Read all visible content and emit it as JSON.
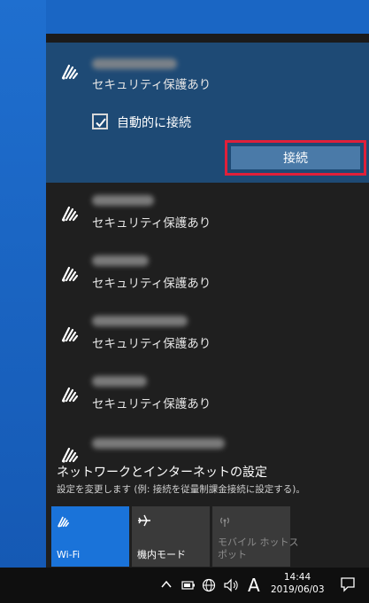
{
  "selected_network": {
    "status": "セキュリティ保護あり",
    "auto_connect_label": "自動的に接続",
    "auto_connect_checked": true,
    "connect_button_label": "接続"
  },
  "networks": [
    {
      "status": "セキュリティ保護あり"
    },
    {
      "status": "セキュリティ保護あり"
    },
    {
      "status": "セキュリティ保護あり"
    },
    {
      "status": "セキュリティ保護あり"
    }
  ],
  "settings": {
    "title": "ネットワークとインターネットの設定",
    "subtitle": "設定を変更します (例: 接続を従量制課金接続に設定する)。"
  },
  "quick_actions": [
    {
      "label": "Wi-Fi",
      "icon": "wifi-icon",
      "active": true
    },
    {
      "label": "機内モード",
      "icon": "airplane-icon",
      "active": false
    },
    {
      "label": "モバイル ホットス\nポット",
      "icon": "hotspot-icon",
      "active": false
    }
  ],
  "taskbar": {
    "ime_indicator": "A",
    "time": "14:44",
    "date": "2019/06/03"
  },
  "colors": {
    "selected_bg": "#1e4a75",
    "connect_button": "#4a7aa8",
    "highlight_border": "#e0203a",
    "wifi_tile": "#1a73d9",
    "flyout_bg": "#1f1f1f"
  }
}
